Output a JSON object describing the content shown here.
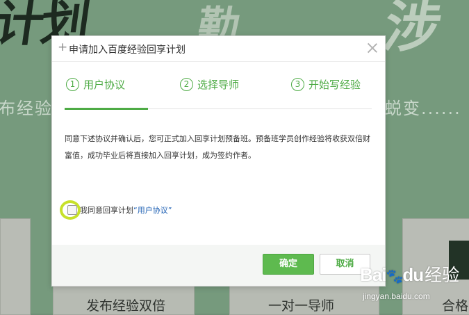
{
  "background": {
    "brush_left": "计划",
    "brush_mid": "勤",
    "brush_right": "涉",
    "tagline_left": "布经验",
    "tagline_right": "蜕变......",
    "cards": [
      "发布经验双倍",
      "一对一导师",
      "合格"
    ]
  },
  "dialog": {
    "title": "申请加入百度经验回享计划",
    "steps": [
      {
        "num": "1",
        "label": "用户协议"
      },
      {
        "num": "2",
        "label": "选择导师"
      },
      {
        "num": "3",
        "label": "开始写经验"
      }
    ],
    "agreement_text": "同意下述协议并确认后，您可正式加入回享计划预备班。预备班学员创作经验将收获双倍财富值，成功毕业后将直接加入回享计划，成为签约作者。",
    "agree_prefix": "我同意回享计划",
    "agree_link": "“用户协议”",
    "ok_label": "确定",
    "cancel_label": "取消"
  },
  "watermark": {
    "logo": "Bai",
    "logo_paw": "🐾",
    "logo_du": "du",
    "jingyan": "经验",
    "url": "jingyan.baidu.com"
  },
  "colors": {
    "accent": "#4eab45",
    "ok_button": "#5eba4f",
    "highlight_ring": "#c7e12a",
    "link": "#1d5fb3"
  }
}
